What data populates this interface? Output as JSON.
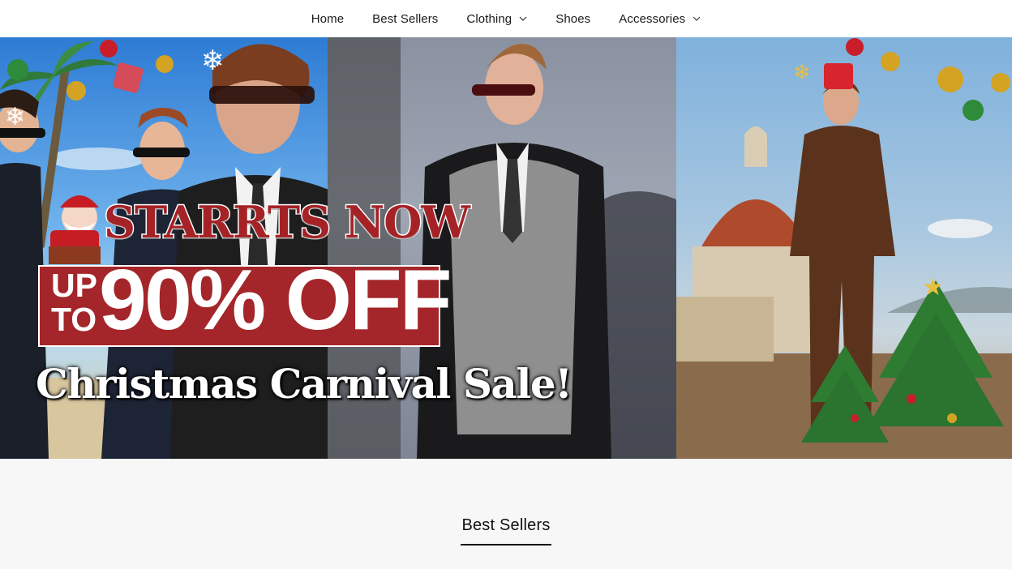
{
  "nav": {
    "items": [
      {
        "label": "Home",
        "has_dropdown": false
      },
      {
        "label": "Best Sellers",
        "has_dropdown": false
      },
      {
        "label": "Clothing",
        "has_dropdown": true
      },
      {
        "label": "Shoes",
        "has_dropdown": false
      },
      {
        "label": "Accessories",
        "has_dropdown": true
      }
    ]
  },
  "hero": {
    "headline": "STARRTS NOW",
    "up_to_line1": "UP",
    "up_to_line2": "TO",
    "discount": "90% OFF",
    "sale_name": "Christmas Carnival Sale!",
    "colors": {
      "banner_red": "#a4262a",
      "headline_red": "#a52226"
    }
  },
  "section": {
    "title": "Best Sellers"
  }
}
